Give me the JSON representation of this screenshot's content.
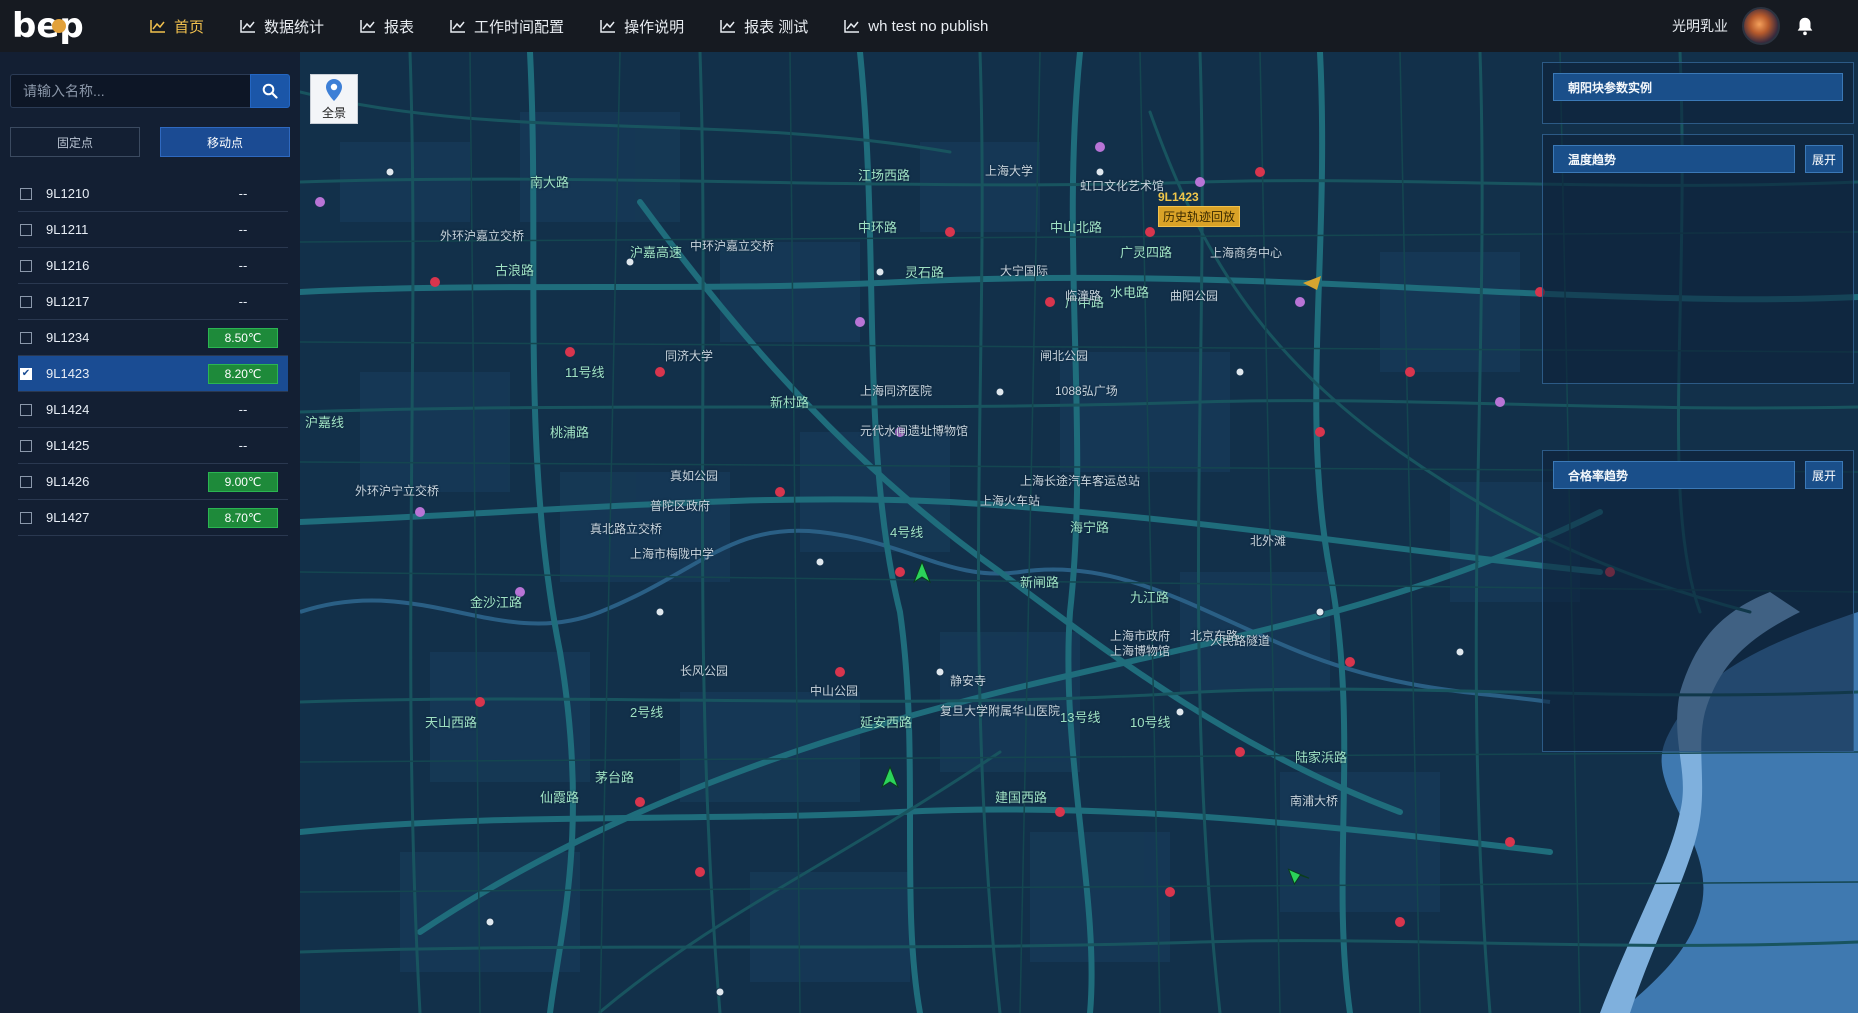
{
  "app": {
    "logo_text": "bep"
  },
  "nav": [
    {
      "label": "首页",
      "active": true
    },
    {
      "label": "数据统计"
    },
    {
      "label": "报表"
    },
    {
      "label": "工作时间配置"
    },
    {
      "label": "操作说明"
    },
    {
      "label": "报表 测试"
    },
    {
      "label": "wh test no publish"
    }
  ],
  "header": {
    "company": "光明乳业"
  },
  "sidebar": {
    "search_placeholder": "请输入名称...",
    "tab_fixed": "固定点",
    "tab_mobile": "移动点",
    "active_tab": "移动点",
    "devices": [
      {
        "name": "9L1210",
        "value": "--",
        "checked": false
      },
      {
        "name": "9L1211",
        "value": "--",
        "checked": false
      },
      {
        "name": "9L1216",
        "value": "--",
        "checked": false
      },
      {
        "name": "9L1217",
        "value": "--",
        "checked": false
      },
      {
        "name": "9L1234",
        "value": "8.50℃",
        "checked": false
      },
      {
        "name": "9L1423",
        "value": "8.20℃",
        "checked": true
      },
      {
        "name": "9L1424",
        "value": "--",
        "checked": false
      },
      {
        "name": "9L1425",
        "value": "--",
        "checked": false
      },
      {
        "name": "9L1426",
        "value": "9.00℃",
        "checked": false
      },
      {
        "name": "9L1427",
        "value": "8.70℃",
        "checked": false
      }
    ]
  },
  "map": {
    "overview_label": "全景",
    "vehicle_id": "9L1423",
    "history_label": "历史轨迹回放",
    "labels": [
      "南大路",
      "古浪路",
      "沪嘉高速",
      "中环沪嘉立交桥",
      "外环沪嘉立交桥",
      "同济大学",
      "江场西路",
      "中环路",
      "灵石路",
      "新村路",
      "上海同济医院",
      "元代水闸遗址博物馆",
      "真如公园",
      "普陀区政府",
      "真北路立交桥",
      "上海市梅陇中学",
      "金沙江路",
      "外环沪宁立交桥",
      "桃浦路",
      "长风公园",
      "中山公园",
      "天山西路",
      "茅台路",
      "仙霞路",
      "延安西路",
      "静安寺",
      "复旦大学附属华山医院",
      "上海市政府",
      "上海博物馆",
      "人民路隧道",
      "海宁路",
      "新闸路",
      "九江路",
      "北京东路",
      "建国西路",
      "陆家浜路",
      "南浦大桥",
      "曲阳公园",
      "闸北公园",
      "上海火车站",
      "1088弘广场",
      "广中路",
      "水电路",
      "广灵四路",
      "中山北路",
      "北外滩",
      "虹口文化艺术馆",
      "上海商务中心",
      "沪嘉线",
      "11号线",
      "2号线",
      "13号线",
      "10号线",
      "4号线",
      "临潼路",
      "上海大学",
      "大宁国际",
      "上海长途汽车客运总站"
    ]
  },
  "panels": [
    {
      "title": "朝阳块参数实例"
    },
    {
      "title": "温度趋势",
      "action": "展开"
    },
    {
      "title": "合格率趋势",
      "action": "展开"
    }
  ],
  "colors": {
    "topbar": "#161a21",
    "nav_active": "#f2c14e",
    "sidebar_bg": "#131f33",
    "selected_row": "#1a4c93",
    "temp_badge": "#1e8a3a",
    "map_bg": "#12304a",
    "river": "#5f93c9"
  }
}
